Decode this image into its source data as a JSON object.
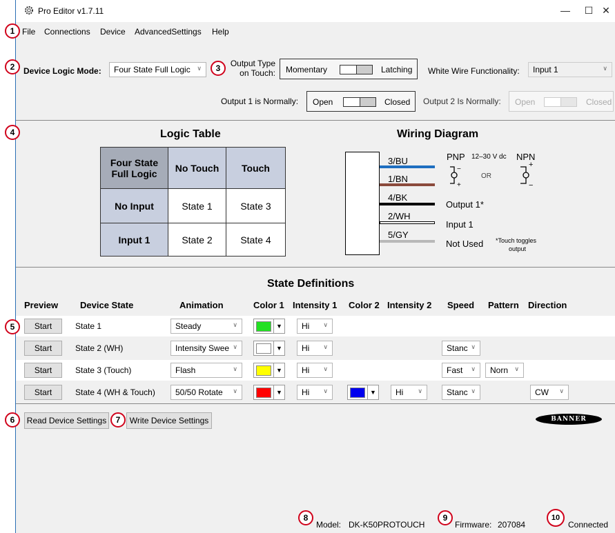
{
  "window": {
    "title": "Pro Editor v1.7.11",
    "minimize": "—",
    "maximize": "☐",
    "close": "✕"
  },
  "menu": [
    "File",
    "Connections",
    "Device",
    "AdvancedSettings",
    "Help"
  ],
  "badges": [
    "1",
    "2",
    "3",
    "4",
    "5",
    "6",
    "7",
    "8",
    "9",
    "10"
  ],
  "settings": {
    "logic_mode_label": "Device Logic Mode:",
    "logic_mode_value": "Four State Full Logic",
    "output_type_label_1": "Output Type",
    "output_type_label_2": "on Touch:",
    "output_type_left": "Momentary",
    "output_type_right": "Latching",
    "white_wire_label": "White Wire Functionality:",
    "white_wire_value": "Input 1",
    "output1_label": "Output 1 is Normally:",
    "output1_left": "Open",
    "output1_right": "Closed",
    "output2_label": "Output 2 Is Normally:",
    "output2_left": "Open",
    "output2_right": "Closed"
  },
  "logic_table": {
    "title": "Logic Table",
    "corner_1": "Four State",
    "corner_2": "Full Logic",
    "col_headers": [
      "No Touch",
      "Touch"
    ],
    "rows": [
      {
        "label": "No Input",
        "cells": [
          "State 1",
          "State 3"
        ]
      },
      {
        "label": "Input 1",
        "cells": [
          "State 2",
          "State 4"
        ]
      }
    ]
  },
  "wiring": {
    "title": "Wiring Diagram",
    "wires": [
      "3/BU",
      "1/BN",
      "4/BK",
      "2/WH",
      "5/GY"
    ],
    "wire_colors": [
      "#1f6fc0",
      "#8b4a3c",
      "#000000",
      "#ffffff",
      "#b8b8b8"
    ],
    "pnp": "PNP",
    "voltage": "12–30 V dc",
    "npn": "NPN",
    "or": "OR",
    "output1": "Output 1*",
    "input1": "Input 1",
    "not_used": "Not Used",
    "note_1": "*Touch toggles",
    "note_2": "output"
  },
  "states": {
    "title": "State Definitions",
    "headers": {
      "preview": "Preview",
      "device_state": "Device State",
      "animation": "Animation",
      "color1": "Color 1",
      "intensity1": "Intensity 1",
      "color2": "Color 2",
      "intensity2": "Intensity 2",
      "speed": "Speed",
      "pattern": "Pattern",
      "direction": "Direction"
    },
    "start_label": "Start",
    "rows": [
      {
        "name": "State 1",
        "animation": "Steady",
        "color1": "#22e022",
        "intensity1": "Hi",
        "color2": "",
        "intensity2": "",
        "speed": "",
        "pattern": "",
        "direction": ""
      },
      {
        "name": "State 2 (WH)",
        "animation": "Intensity Swee",
        "color1": "#ffffff",
        "intensity1": "Hi",
        "color2": "",
        "intensity2": "",
        "speed": "Stanc",
        "pattern": "",
        "direction": ""
      },
      {
        "name": "State 3 (Touch)",
        "animation": "Flash",
        "color1": "#ffff00",
        "intensity1": "Hi",
        "color2": "",
        "intensity2": "",
        "speed": "Fast",
        "pattern": "Norn",
        "direction": ""
      },
      {
        "name": "State 4 (WH & Touch)",
        "animation": "50/50 Rotate",
        "color1": "#ff0000",
        "intensity1": "Hi",
        "color2": "#0000ee",
        "intensity2": "Hi",
        "speed": "Stanc",
        "pattern": "",
        "direction": "CW"
      }
    ]
  },
  "actions": {
    "read": "Read Device Settings",
    "write": "Write Device Settings"
  },
  "brand": "BANNER",
  "status": {
    "model_label": "Model:",
    "model_value": "DK-K50PROTOUCH",
    "firmware_label": "Firmware:",
    "firmware_value": "207084",
    "connection": "Connected"
  }
}
